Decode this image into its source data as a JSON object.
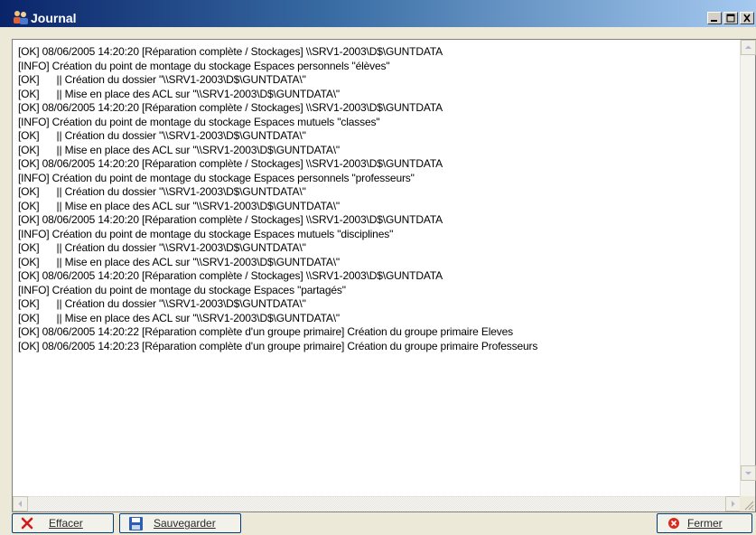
{
  "window": {
    "title": "Journal"
  },
  "title_buttons": {
    "minimize": "minimize-icon",
    "maximize": "maximize-icon",
    "close": "close-icon"
  },
  "log": {
    "lines": [
      "[OK] 08/06/2005 14:20:20 [Réparation complète / Stockages] \\\\SRV1-2003\\D$\\GUNTDATA",
      "[INFO] Création du point de montage du stockage Espaces personnels \"élèves\"",
      "[OK]      || Création du dossier \"\\\\SRV1-2003\\D$\\GUNTDATA\\\"",
      "[OK]      || Mise en place des ACL sur \"\\\\SRV1-2003\\D$\\GUNTDATA\\\"",
      "[OK] 08/06/2005 14:20:20 [Réparation complète / Stockages] \\\\SRV1-2003\\D$\\GUNTDATA",
      "[INFO] Création du point de montage du stockage Espaces mutuels \"classes\"",
      "[OK]      || Création du dossier \"\\\\SRV1-2003\\D$\\GUNTDATA\\\"",
      "[OK]      || Mise en place des ACL sur \"\\\\SRV1-2003\\D$\\GUNTDATA\\\"",
      "[OK] 08/06/2005 14:20:20 [Réparation complète / Stockages] \\\\SRV1-2003\\D$\\GUNTDATA",
      "[INFO] Création du point de montage du stockage Espaces personnels \"professeurs\"",
      "[OK]      || Création du dossier \"\\\\SRV1-2003\\D$\\GUNTDATA\\\"",
      "[OK]      || Mise en place des ACL sur \"\\\\SRV1-2003\\D$\\GUNTDATA\\\"",
      "[OK] 08/06/2005 14:20:20 [Réparation complète / Stockages] \\\\SRV1-2003\\D$\\GUNTDATA",
      "[INFO] Création du point de montage du stockage Espaces mutuels \"disciplines\"",
      "[OK]      || Création du dossier \"\\\\SRV1-2003\\D$\\GUNTDATA\\\"",
      "[OK]      || Mise en place des ACL sur \"\\\\SRV1-2003\\D$\\GUNTDATA\\\"",
      "[OK] 08/06/2005 14:20:20 [Réparation complète / Stockages] \\\\SRV1-2003\\D$\\GUNTDATA",
      "[INFO] Création du point de montage du stockage Espaces \"partagés\"",
      "[OK]      || Création du dossier \"\\\\SRV1-2003\\D$\\GUNTDATA\\\"",
      "[OK]      || Mise en place des ACL sur \"\\\\SRV1-2003\\D$\\GUNTDATA\\\"",
      "[OK] 08/06/2005 14:20:22 [Réparation complète d'un groupe primaire] Création du groupe primaire Eleves",
      "[OK] 08/06/2005 14:20:23 [Réparation complète d'un groupe primaire] Création du groupe primaire Professeurs"
    ]
  },
  "buttons": {
    "effacer": {
      "label": "Effacer",
      "icon": "red-x-icon"
    },
    "sauvegarder": {
      "label": "Sauvegarder",
      "icon": "floppy-disk-icon"
    },
    "fermer": {
      "label": "Fermer",
      "icon": "red-stop-icon"
    }
  },
  "colors": {
    "titlebar_start": "#0a246a",
    "titlebar_end": "#a6caf0",
    "button_border": "#003c74",
    "delete_red": "#d21a1a"
  }
}
